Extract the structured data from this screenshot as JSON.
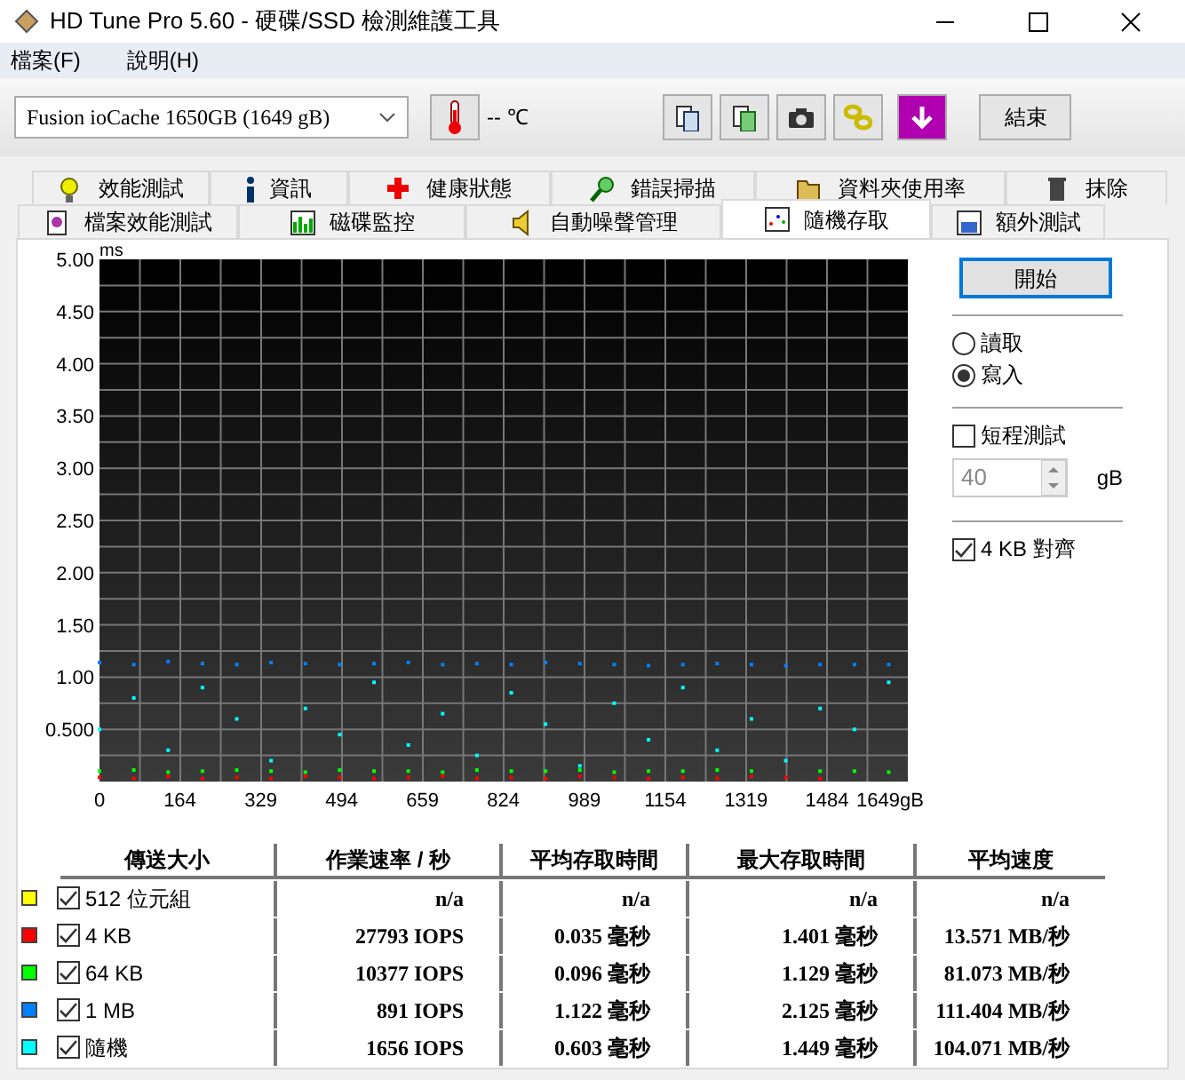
{
  "window": {
    "title": "HD Tune Pro 5.60 - 硬碟/SSD 檢測維護工具"
  },
  "menu": [
    "檔案(F)",
    "說明(H)"
  ],
  "toolbar": {
    "drive": "Fusion ioCache 1650GB  (1649 gB)",
    "temperature": "-- ℃",
    "exit": "結束"
  },
  "tabs": [
    [
      {
        "label": "效能測試",
        "selected": false
      },
      {
        "label": "資訊",
        "selected": false
      },
      {
        "label": "健康狀態",
        "selected": false
      },
      {
        "label": "錯誤掃描",
        "selected": false
      },
      {
        "label": "資料夾使用率",
        "selected": false
      },
      {
        "label": "抹除",
        "selected": false
      }
    ],
    [
      {
        "label": "檔案效能測試",
        "selected": false
      },
      {
        "label": "磁碟監控",
        "selected": false
      },
      {
        "label": "自動噪聲管理",
        "selected": false
      },
      {
        "label": "隨機存取",
        "selected": true
      },
      {
        "label": "額外測試",
        "selected": false
      }
    ]
  ],
  "chart": {
    "chart_data": {
      "type": "scatter",
      "grid": true,
      "ylabel": "ms",
      "xlim": [
        0,
        1649
      ],
      "ylim": [
        0,
        5
      ],
      "xticks": [
        0,
        164,
        329,
        494,
        659,
        824,
        989,
        1154,
        1319,
        1484,
        {
          "value": 1649,
          "label": "1649gB"
        }
      ],
      "yticks": [
        {
          "value": 0.5,
          "label": "0.500"
        },
        {
          "value": 1,
          "label": "1.00"
        },
        {
          "value": 1.5,
          "label": "1.50"
        },
        {
          "value": 2,
          "label": "2.00"
        },
        {
          "value": 2.5,
          "label": "2.50"
        },
        {
          "value": 3,
          "label": "3.00"
        },
        {
          "value": 3.5,
          "label": "3.50"
        },
        {
          "value": 4,
          "label": "4.00"
        },
        {
          "value": 4.5,
          "label": "4.50"
        },
        {
          "value": 5,
          "label": "5.00"
        }
      ],
      "x": [
        0,
        70,
        140,
        210,
        280,
        350,
        420,
        490,
        560,
        630,
        700,
        770,
        840,
        910,
        980,
        1050,
        1120,
        1190,
        1260,
        1330,
        1400,
        1470,
        1540,
        1610
      ],
      "series": [
        {
          "color": "#ff0000",
          "values": [
            0.04,
            0.03,
            0.05,
            0.03,
            0.04,
            0.03,
            0.05,
            0.04,
            0.03,
            0.04,
            0.05,
            0.03,
            0.04,
            0.03,
            0.05,
            0.04,
            0.03,
            0.04,
            0.03,
            0.05,
            0.04,
            0.03,
            null,
            null
          ]
        },
        {
          "color": "#00ff00",
          "values": [
            0.1,
            0.11,
            0.09,
            0.1,
            0.11,
            0.1,
            0.09,
            0.11,
            0.1,
            0.1,
            0.09,
            0.11,
            0.1,
            0.1,
            0.11,
            0.09,
            0.1,
            0.1,
            0.11,
            0.1,
            null,
            0.1,
            0.1,
            0.09
          ]
        },
        {
          "color": "#0080ff",
          "values": [
            1.14,
            1.12,
            1.15,
            1.13,
            1.12,
            1.14,
            1.13,
            1.12,
            1.13,
            1.14,
            1.12,
            1.13,
            1.12,
            1.14,
            1.13,
            1.12,
            1.11,
            1.12,
            1.13,
            1.12,
            1.11,
            1.12,
            1.12,
            1.12
          ]
        },
        {
          "color": "#00ffff",
          "values": [
            0.5,
            0.8,
            0.3,
            0.9,
            0.6,
            0.2,
            0.7,
            0.45,
            0.95,
            0.35,
            0.65,
            0.25,
            0.85,
            0.55,
            0.15,
            0.75,
            0.4,
            0.9,
            0.3,
            0.6,
            0.2,
            0.7,
            0.5,
            0.95
          ]
        }
      ]
    }
  },
  "controls": {
    "start": "開始",
    "modes": [
      {
        "label": "讀取",
        "selected": false
      },
      {
        "label": "寫入",
        "selected": true
      }
    ],
    "short_test": {
      "label": "短程測試",
      "checked": false
    },
    "size": {
      "value": "40",
      "unit": "gB",
      "disabled": true
    },
    "align": {
      "label": "4 KB 對齊",
      "checked": true
    }
  },
  "table": {
    "columns": [
      "傳送大小",
      "作業速率 / 秒",
      "平均存取時間",
      "最大存取時間",
      "平均速度"
    ],
    "rows": [
      {
        "color": "#ffff00",
        "checked": true,
        "cells": [
          "512 位元組",
          "n/a",
          "n/a",
          "n/a",
          "n/a"
        ]
      },
      {
        "color": "#ff0000",
        "checked": true,
        "cells": [
          "4 KB",
          "27793 IOPS",
          "0.035 毫秒",
          "1.401 毫秒",
          "13.571 MB/秒"
        ]
      },
      {
        "color": "#00ff00",
        "checked": true,
        "cells": [
          "64 KB",
          "10377 IOPS",
          "0.096 毫秒",
          "1.129 毫秒",
          "81.073 MB/秒"
        ]
      },
      {
        "color": "#0080ff",
        "checked": true,
        "cells": [
          "1 MB",
          "891 IOPS",
          "1.122 毫秒",
          "2.125 毫秒",
          "111.404 MB/秒"
        ]
      },
      {
        "color": "#00ffff",
        "checked": true,
        "cells": [
          "隨機",
          "1656 IOPS",
          "0.603 毫秒",
          "1.449 毫秒",
          "104.071 MB/秒"
        ]
      }
    ]
  }
}
